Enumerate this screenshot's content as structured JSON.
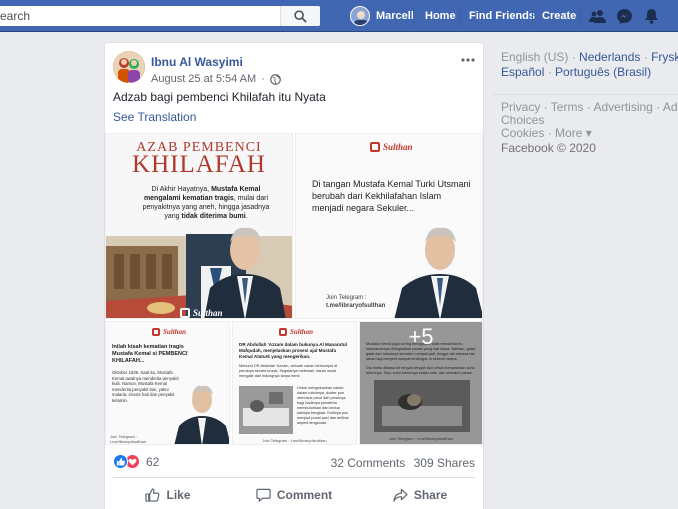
{
  "topbar": {
    "search_placeholder": "earch",
    "user_name": "Marcell",
    "nav": {
      "home": "Home",
      "find_friends": "Find Friends",
      "create": "Create"
    }
  },
  "post": {
    "author": "Ibnu Al Wasyimi",
    "date": "August 25 at 5:54 AM",
    "dot": "·",
    "text": "Adzab bagi pembenci Khilafah itu Nyata",
    "see_translation": "See Translation",
    "images": {
      "t1": {
        "title_line1": "AZAB PEMBENCI",
        "title_line2": "KHILAFAH",
        "body_pre": "Di Akhir Hayatnya, ",
        "body_bold": "Mustafa Kemal mengalami kematian tragis",
        "body_mid": ", mulai dari penyakitnya yang aneh, hingga jasadnya yang ",
        "body_strong": "tidak diterima bumi",
        "body_end": "."
      },
      "t2": {
        "logo": "Sulthan",
        "body": "Di tangan Mustafa Kemal Turki Utsmani berubah dari Kekhilafahan Islam menjadi negara Sekuler...",
        "join": "Join Telegram :",
        "join_link": "t.me/libraryofsulthan"
      },
      "t3": {
        "logo": "Sulthan",
        "heading": "Inilah kisah kematian tragis Mustafa Kemal si PEMBENCI KHILAFAH...",
        "body": "Oktober 1938. Saat itu, Mustafa Kemal awalnya menderita penyakit kulit. Namun, Mustafa Kemal menderita penyakit lain, yakni malaria, sirosis hati dan penyakit kelamin.",
        "join": "Join Telegram :",
        "join_link": "t.me/libraryofsulthan"
      },
      "t4": {
        "logo": "Sulthan",
        "heading": "DR Abdullah 'Azzam dalam bukunya Al Manarutul Mafqudah, menjelaskan prosesi ajal Mustafa Kemal Ataturk yang mengerikan.",
        "body1": "Menurut DR Abdullah 'Azzam, sebuah cairan berkumpul di perutnya secara kronis. Segalanya melemah, darah mulai mengalir dari hidungnya tanpa henti.",
        "body2": "Untuk mengeluarkan cairan dalam tubuhnya, dokter pun menusuk perut dari perutnya, bagi hadirnya penderita membutuhkan dan kedua kakinya bengkak. Kulitnya pun menjadi pucat pasi dan terlihat seperti tengkorak.",
        "join": "Join Telegram : t.me/libraryofsulthan"
      },
      "t5": {
        "more_label": "+5",
        "body1": "Mustafa Kemal juga sering mengalami sakit menderita itu, keamanannya ditingkatkan panas yang luar biasa. Bahkan, gatal-gatal dari tubuhnya semakin menjadi-jadi, hingga dia merasa tak tahan lagi menjerit sampai terdengar di seluruh Istana.",
        "body2": "Dia minta dibawa ke tengah-tengah laut untuk menurunkan suhu tubuhnya. Tapi, suhu tubuhnya selalu naik, dan semakin panas.",
        "join": "Join Telegram : t.me/libraryofsulthan"
      }
    },
    "reaction_count": "62",
    "comments": "32 Comments",
    "shares": "309 Shares",
    "actions": {
      "like": "Like",
      "comment": "Comment",
      "share": "Share"
    }
  },
  "sidebar": {
    "languages": [
      "English (US)",
      "Nederlands",
      "Frysk",
      "Español",
      "Português (Brasil)"
    ],
    "links": [
      "Privacy",
      "Terms",
      "Advertising",
      "Ad Choices",
      "Cookies",
      "More"
    ],
    "more_arrow": "▾",
    "copyright": "Facebook © 2020"
  },
  "colors": {
    "brand_blue": "#4267b2",
    "link_blue": "#365899",
    "like_blue": "#1877f2",
    "love_red": "#f33e58",
    "text_muted": "#606770"
  }
}
